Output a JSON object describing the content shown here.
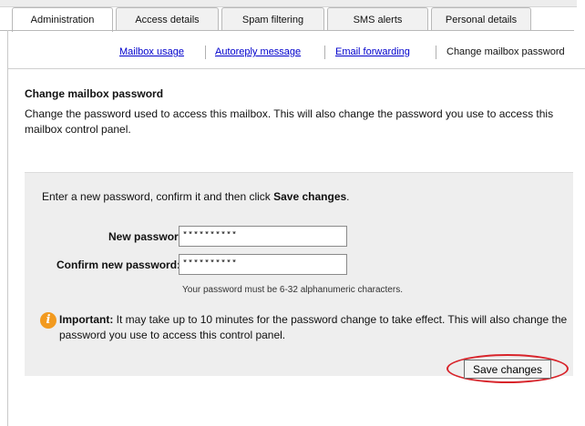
{
  "tabs": [
    {
      "label": "Administration",
      "active": true
    },
    {
      "label": "Access details",
      "active": false
    },
    {
      "label": "Spam filtering",
      "active": false
    },
    {
      "label": "SMS alerts",
      "active": false
    },
    {
      "label": "Personal details",
      "active": false
    }
  ],
  "subnav": {
    "links": [
      "Mailbox usage",
      "Autoreply message",
      "Email forwarding"
    ],
    "current": "Change mailbox password"
  },
  "section": {
    "title": "Change mailbox password",
    "description": "Change the password used to access this mailbox. This will also change the password you use to access this mailbox control panel."
  },
  "form": {
    "intro_prefix": "Enter a new password, confirm it and then click ",
    "intro_bold": "Save changes",
    "intro_suffix": ".",
    "new_password_label": "New password:",
    "new_password_value": "**********",
    "confirm_password_label": "Confirm new password:",
    "confirm_password_value": "**********",
    "hint": "Your password must be 6-32 alphanumeric characters.",
    "note_icon": "info-icon",
    "note_glyph": "i",
    "note_bold": "Important:",
    "note_text": " It may take up to 10 minutes for the password change to take effect. This will also change the password you use to access this control panel.",
    "save_label": "Save changes"
  },
  "colors": {
    "link": "#0000cc",
    "info_icon": "#f29a1f",
    "highlight_ring": "#d8232a",
    "form_background": "#eeeeee"
  }
}
